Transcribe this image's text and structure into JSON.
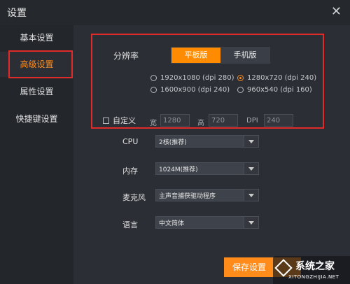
{
  "window": {
    "title": "设置",
    "close_glyph": "✕"
  },
  "sidebar": {
    "items": [
      {
        "label": "基本设置"
      },
      {
        "label": "高级设置"
      },
      {
        "label": "属性设置"
      },
      {
        "label": "快捷键设置"
      }
    ],
    "active_index": 1
  },
  "resolution": {
    "label": "分辨率",
    "modes": [
      "平板版",
      "手机版"
    ],
    "selected_mode": "平板版",
    "options": [
      "1920x1080 (dpi 280)",
      "1280x720 (dpi 240)",
      "1600x900 (dpi 240)",
      "960x540 (dpi 160)"
    ],
    "selected_option": "1280x720 (dpi 240)",
    "custom": {
      "label": "自定义",
      "width_label": "宽",
      "width_value": "1280",
      "height_label": "高",
      "height_value": "720",
      "dpi_label": "DPI",
      "dpi_value": "240"
    }
  },
  "settings": {
    "cpu_label": "CPU",
    "cpu_value": "2核(推荐)",
    "memory_label": "内存",
    "memory_value": "1024M(推荐)",
    "mic_label": "麦克风",
    "mic_value": "主声音捕获驱动程序",
    "language_label": "语言",
    "language_value": "中文简体"
  },
  "actions": {
    "save_label": "保存设置"
  },
  "watermark": {
    "text": "系统之家",
    "subtext": "XITONGZHIJIA.NET"
  },
  "colors": {
    "accent": "#ff8c1a",
    "highlight": "#e02b2b",
    "background": "#2b2e34"
  }
}
